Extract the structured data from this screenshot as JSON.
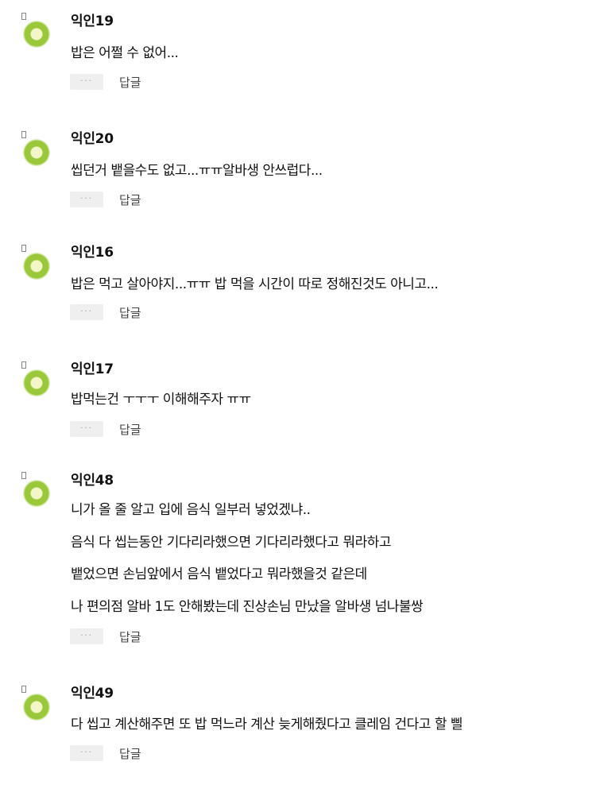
{
  "comments": [
    {
      "author": "익인19",
      "lines": [
        "밥은 어쩔 수 없어..."
      ],
      "reply_label": "답글",
      "more_label": "···"
    },
    {
      "author": "익인20",
      "lines": [
        "씹던거 뱉을수도 없고...ㅠㅠ알바생 안쓰럽다..."
      ],
      "reply_label": "답글",
      "more_label": "···"
    },
    {
      "author": "익인16",
      "lines": [
        "밥은 먹고 살아야지...ㅠㅠ 밥 먹을 시간이 따로 정해진것도 아니고..."
      ],
      "reply_label": "답글",
      "more_label": "···"
    },
    {
      "author": "익인17",
      "lines": [
        "밥먹는건 ㅜㅜㅜ 이해해주자 ㅠㅠ"
      ],
      "reply_label": "답글",
      "more_label": "···"
    },
    {
      "author": "익인48",
      "lines": [
        "니가 올 줄 알고 입에 음식 일부러 넣었겠냐..",
        "음식 다 씹는동안 기다리라했으면 기다리라했다고 뭐라하고",
        "뱉었으면 손님앞에서 음식 뱉었다고 뭐라했을것 같은데",
        "나 편의점 알바 1도 안해봤는데 진상손님 만났을 알바생 넘나불쌍"
      ],
      "reply_label": "답글",
      "more_label": "···"
    },
    {
      "author": "익인49",
      "lines": [
        "다 씹고 계산해주면 또 밥 먹느라 계산 늦게해줬다고 클레임 건다고 할 삘"
      ],
      "reply_label": "답글",
      "more_label": "···"
    }
  ]
}
